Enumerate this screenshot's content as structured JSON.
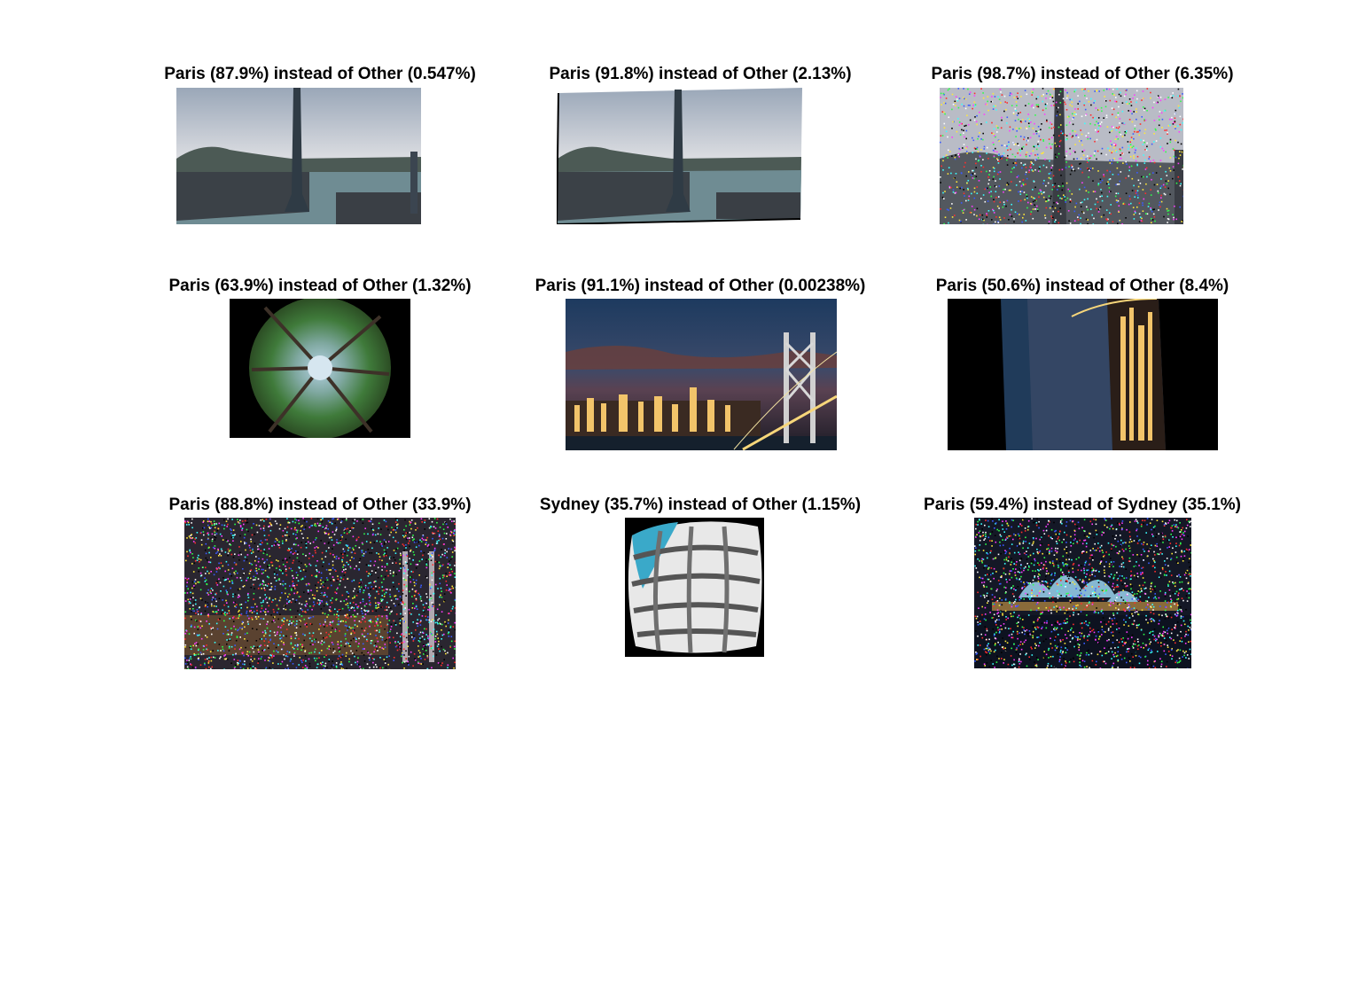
{
  "panels": [
    {
      "title": "Paris (87.9%) instead of Other (0.547%)",
      "image": "hong-kong-skyline-tower-photo"
    },
    {
      "title": "Paris (91.8%) instead of Other (2.13%)",
      "image": "hong-kong-skyline-tower-rotated-photo"
    },
    {
      "title": "Paris (98.7%) instead of Other (6.35%)",
      "image": "hong-kong-skyline-tower-noisy-photo"
    },
    {
      "title": "Paris (63.9%) instead of Other (1.32%)",
      "image": "fisheye-forest-canopy-photo"
    },
    {
      "title": "Paris (91.1%) instead of Other (0.00238%)",
      "image": "bay-bridge-night-city-photo"
    },
    {
      "title": "Paris (50.6%) instead of Other (8.4%)",
      "image": "rotated-night-city-photo"
    },
    {
      "title": "Paris (88.8%) instead of Other (33.9%)",
      "image": "bay-bridge-night-noisy-photo"
    },
    {
      "title": "Sydney (35.7%) instead of Other (1.15%)",
      "image": "fisheye-white-building-facade-photo"
    },
    {
      "title": "Paris (59.4%) instead of Sydney (35.1%)",
      "image": "sydney-opera-house-night-noisy-photo"
    }
  ],
  "colors": {
    "background": "#ffffff",
    "title_text": "#000000"
  }
}
